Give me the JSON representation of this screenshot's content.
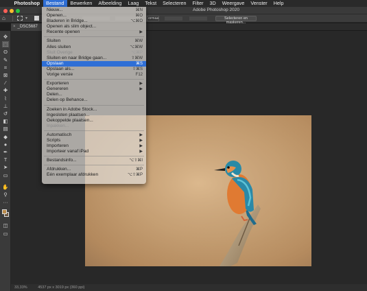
{
  "menubar": {
    "app": "Photoshop",
    "items": [
      "Bestand",
      "Bewerken",
      "Afbeelding",
      "Laag",
      "Tekst",
      "Selecteren",
      "Filter",
      "3D",
      "Weergave",
      "Venster",
      "Help"
    ]
  },
  "window": {
    "title": "Adobe Photoshop 2020"
  },
  "options": {
    "style_value": "ormaal",
    "select_mask_label": "Selecteren en maskeren..."
  },
  "document_tab": {
    "name": "_DSC5687"
  },
  "status": {
    "zoom": "33,33%",
    "doc_info": "4537 px x 3019 px (360 ppi)"
  },
  "colors": {
    "accent": "#2f6fd6",
    "foreground_swatch": "#b98a4a",
    "background_swatch": "#6b5640"
  },
  "menu": {
    "groups": [
      [
        {
          "label": "Nieuw...",
          "shortcut": "⌘N",
          "disabled": false,
          "submenu": false
        },
        {
          "label": "Openen...",
          "shortcut": "⌘O",
          "disabled": false,
          "submenu": false
        },
        {
          "label": "Bladeren in Bridge...",
          "shortcut": "⌥⌘O",
          "disabled": false,
          "submenu": false
        },
        {
          "label": "Openen als slim object...",
          "shortcut": "",
          "disabled": false,
          "submenu": false
        },
        {
          "label": "Recente openen",
          "shortcut": "▶",
          "disabled": false,
          "submenu": true
        }
      ],
      [
        {
          "label": "Sluiten",
          "shortcut": "⌘W",
          "disabled": false,
          "submenu": false
        },
        {
          "label": "Alles sluiten",
          "shortcut": "⌥⌘W",
          "disabled": false,
          "submenu": false
        },
        {
          "label": "Sluit Overige",
          "shortcut": "⌥⌘P",
          "disabled": true,
          "submenu": false
        },
        {
          "label": "Sluiten en naar Bridge gaan...",
          "shortcut": "⇧⌘W",
          "disabled": false,
          "submenu": false
        },
        {
          "label": "Opslaan",
          "shortcut": "⌘S",
          "disabled": false,
          "submenu": false,
          "highlighted": true
        },
        {
          "label": "Opslaan als...",
          "shortcut": "⇧⌘S",
          "disabled": false,
          "submenu": false
        },
        {
          "label": "Vorige versie",
          "shortcut": "F12",
          "disabled": false,
          "submenu": false
        }
      ],
      [
        {
          "label": "Exporteren",
          "shortcut": "▶",
          "disabled": false,
          "submenu": true
        },
        {
          "label": "Genereren",
          "shortcut": "▶",
          "disabled": false,
          "submenu": true
        },
        {
          "label": "Delen...",
          "shortcut": "",
          "disabled": false,
          "submenu": false
        },
        {
          "label": "Delen op Behance...",
          "shortcut": "",
          "disabled": false,
          "submenu": false
        }
      ],
      [
        {
          "label": "Zoeken in Adobe Stock...",
          "shortcut": "",
          "disabled": false,
          "submenu": false
        },
        {
          "label": "Ingesloten plaatsen...",
          "shortcut": "",
          "disabled": false,
          "submenu": false
        },
        {
          "label": "Gekoppelde plaatsen...",
          "shortcut": "",
          "disabled": false,
          "submenu": false
        },
        {
          "label": "Inpakken...",
          "shortcut": "",
          "disabled": true,
          "submenu": false
        }
      ],
      [
        {
          "label": "Automatisch",
          "shortcut": "▶",
          "disabled": false,
          "submenu": true
        },
        {
          "label": "Scripts",
          "shortcut": "▶",
          "disabled": false,
          "submenu": true
        },
        {
          "label": "Importeren",
          "shortcut": "▶",
          "disabled": false,
          "submenu": true
        },
        {
          "label": "Importeer vanaf iPad",
          "shortcut": "▶",
          "disabled": false,
          "submenu": true
        }
      ],
      [
        {
          "label": "Bestandsinfo...",
          "shortcut": "⌥⇧⌘I",
          "disabled": false,
          "submenu": false
        }
      ],
      [
        {
          "label": "Afdrukken...",
          "shortcut": "⌘P",
          "disabled": false,
          "submenu": false
        },
        {
          "label": "Eén exemplaar afdrukken",
          "shortcut": "⌥⇧⌘P",
          "disabled": false,
          "submenu": false
        }
      ]
    ]
  },
  "tools": [
    {
      "name": "move-tool-icon",
      "glyph": "✥"
    },
    {
      "name": "marquee-tool-icon",
      "glyph": "⬚",
      "selected": true
    },
    {
      "name": "lasso-tool-icon",
      "glyph": "ʘ"
    },
    {
      "name": "quick-select-tool-icon",
      "glyph": "✎"
    },
    {
      "name": "crop-tool-icon",
      "glyph": "⌗"
    },
    {
      "name": "frame-tool-icon",
      "glyph": "⊠"
    },
    {
      "name": "eyedropper-tool-icon",
      "glyph": "⁄"
    },
    {
      "name": "healing-brush-tool-icon",
      "glyph": "✚"
    },
    {
      "name": "brush-tool-icon",
      "glyph": "⌇"
    },
    {
      "name": "clone-stamp-tool-icon",
      "glyph": "⊥"
    },
    {
      "name": "history-brush-tool-icon",
      "glyph": "↺"
    },
    {
      "name": "eraser-tool-icon",
      "glyph": "◧"
    },
    {
      "name": "gradient-tool-icon",
      "glyph": "▤"
    },
    {
      "name": "blur-tool-icon",
      "glyph": "◆"
    },
    {
      "name": "dodge-tool-icon",
      "glyph": "●"
    },
    {
      "name": "pen-tool-icon",
      "glyph": "✒"
    },
    {
      "name": "type-tool-icon",
      "glyph": "T"
    },
    {
      "name": "path-select-tool-icon",
      "glyph": "➤"
    },
    {
      "name": "rectangle-tool-icon",
      "glyph": "▭"
    },
    {
      "name": "hand-tool-icon",
      "glyph": "✋"
    },
    {
      "name": "zoom-tool-icon",
      "glyph": "⚲"
    },
    {
      "name": "more-tools-icon",
      "glyph": "···"
    }
  ]
}
